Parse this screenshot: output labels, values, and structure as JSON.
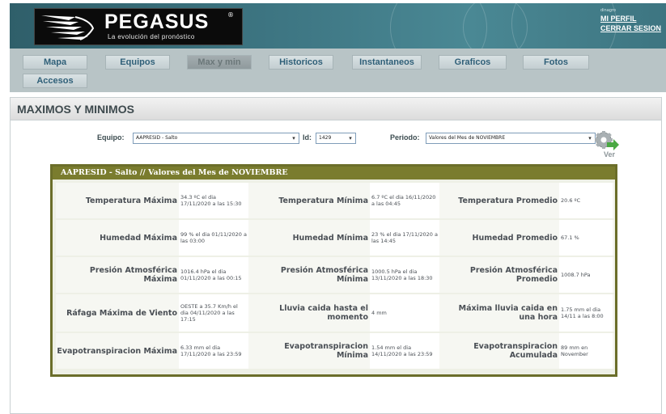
{
  "header": {
    "brand": "PEGASUS",
    "registered": "®",
    "tagline": "La evolución del pronóstico",
    "user_name": "dinagro",
    "profile_link": "MI PERFIL",
    "logout_link": "CERRAR SESION"
  },
  "nav": {
    "tabs": [
      "Mapa",
      "Equipos",
      "Max y min",
      "Historicos",
      "Instantaneos",
      "Graficos",
      "Fotos",
      "Accesos"
    ],
    "active": "Max y min"
  },
  "page": {
    "title": "MAXIMOS Y MINIMOS"
  },
  "filters": {
    "equipo_label": "Equipo:",
    "equipo_value": "AAPRESID - Salto",
    "id_label": "Id:",
    "id_value": "1429",
    "periodo_label": "Periodo:",
    "periodo_value": "Valores del Mes de NOVIEMBRE",
    "ver_label": "Ver"
  },
  "results": {
    "heading": "AAPRESID - Salto // Valores del Mes de NOVIEMBRE",
    "rows": [
      [
        {
          "label": "Temperatura Máxima",
          "value": "34.3 ºC el dia 17/11/2020 a las 15:30"
        },
        {
          "label": "Temperatura Mínima",
          "value": "6.7 ºC el dia 16/11/2020 a las 04:45"
        },
        {
          "label": "Temperatura Promedio",
          "value": "20.6 ºC"
        }
      ],
      [
        {
          "label": "Humedad Máxima",
          "value": "99 % el dia 01/11/2020 a las 03:00"
        },
        {
          "label": "Humedad Mínima",
          "value": "23 % el dia 17/11/2020 a las 14:45"
        },
        {
          "label": "Humedad Promedio",
          "value": "67.1 %"
        }
      ],
      [
        {
          "label": "Presión Atmosférica Máxima",
          "value": "1016.4 hPa el dia 01/11/2020 a las 00:15"
        },
        {
          "label": "Presión Atmosférica Mínima",
          "value": "1000.5 hPa el dia 13/11/2020 a las 18:30"
        },
        {
          "label": "Presión Atmosférica Promedio",
          "value": "1008.7 hPa"
        }
      ],
      [
        {
          "label": "Ráfaga Máxima de Viento",
          "value": "OESTE a 35.7 Km/h el dia 04/11/2020 a las 17:15"
        },
        {
          "label": "Lluvia caida hasta el momento",
          "value": "4 mm"
        },
        {
          "label": "Máxima lluvia caida en una hora",
          "value": "1.75 mm el dia 14/11 a las 8:00"
        }
      ],
      [
        {
          "label": "Evapotranspiracion Máxima",
          "value": "6.33 mm el dia 17/11/2020 a las 23:59"
        },
        {
          "label": "Evapotranspiracion Mínima",
          "value": "1.54 mm el dia 14/11/2020 a las 23:59"
        },
        {
          "label": "Evapotranspiracion Acumulada",
          "value": "89 mm en November"
        }
      ]
    ]
  },
  "colors": {
    "header_teal": "#3f7885",
    "nav_bg": "#b8c4c6",
    "tab_text": "#2f5f78",
    "results_border": "#6b6e2a",
    "results_head": "#7a7c2e"
  },
  "icons": {
    "ver": "gear-arrow-icon",
    "logo": "pegasus-wing-logo"
  }
}
